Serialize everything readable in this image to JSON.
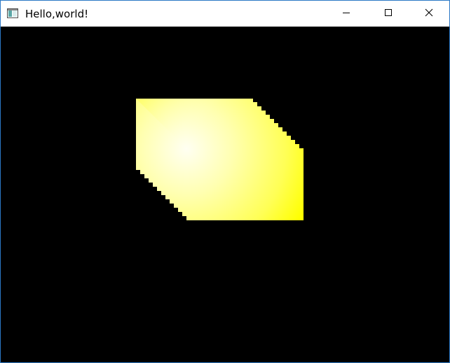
{
  "window": {
    "title": "Hello,world!"
  },
  "titlebar": {
    "icons": {
      "app": "app-window-icon",
      "minimize": "minimize-icon",
      "maximize": "maximize-icon",
      "close": "close-icon"
    }
  },
  "scene": {
    "background_color": "#000000",
    "object": "yellow-cube",
    "cube_color": "#ffff00",
    "highlight_color": "#ffffe8"
  }
}
